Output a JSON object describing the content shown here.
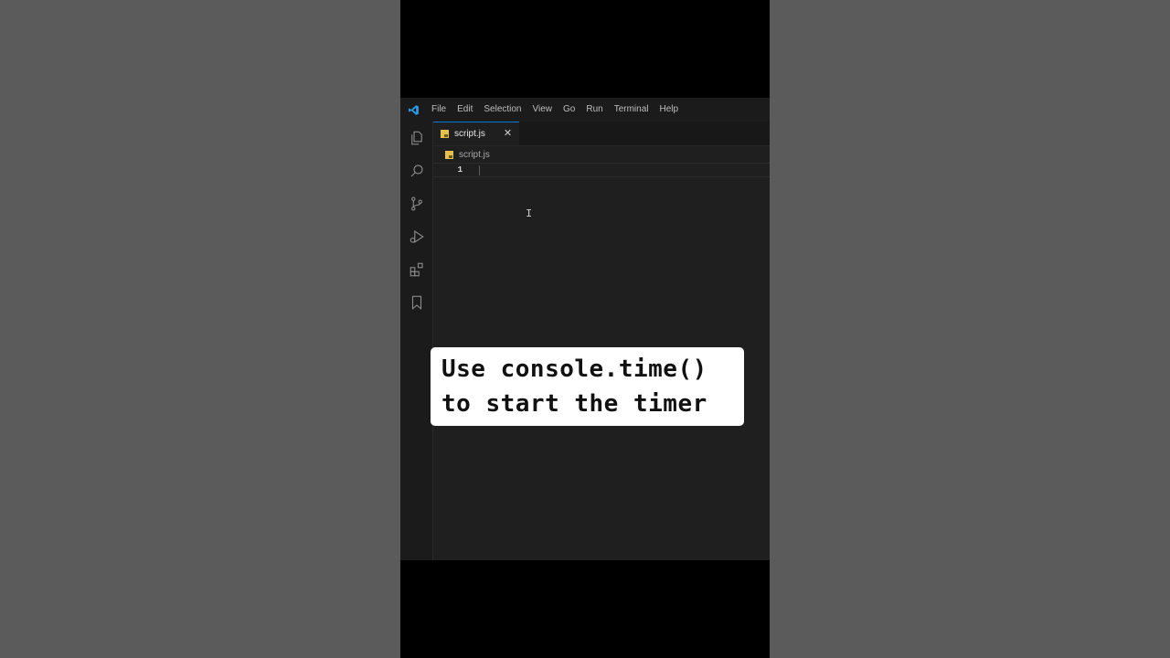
{
  "menu": {
    "items": [
      "File",
      "Edit",
      "Selection",
      "View",
      "Go",
      "Run",
      "Terminal",
      "Help"
    ]
  },
  "tab": {
    "label": "script.js",
    "close_glyph": "✕"
  },
  "breadcrumb": {
    "file": "script.js"
  },
  "editor": {
    "line_number": "1"
  },
  "caption": {
    "line1": "Use console.time()",
    "line2": "to start the timer"
  },
  "icons": {
    "app": "vscode-logo-icon",
    "activity": [
      "explorer-icon",
      "search-icon",
      "source-control-icon",
      "run-debug-icon",
      "extensions-icon",
      "bookmark-icon"
    ]
  },
  "colors": {
    "accent": "#0078d4",
    "js_badge": "#e5c04a",
    "editor_bg": "#1f1f1f"
  }
}
